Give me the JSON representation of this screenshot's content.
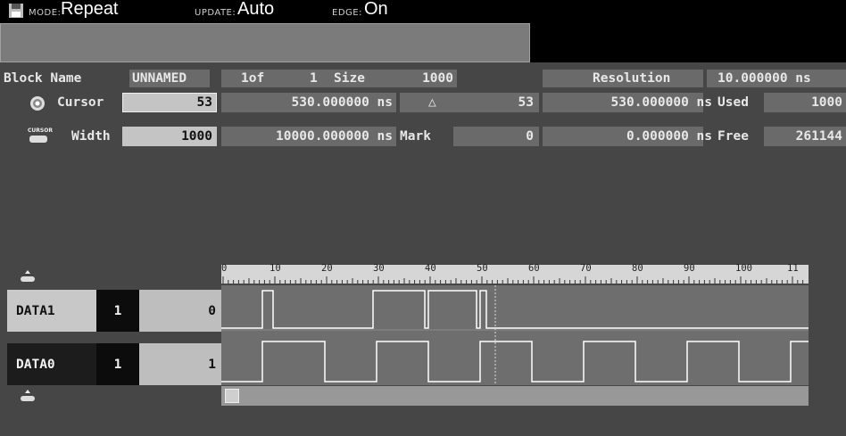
{
  "topbar": {
    "mode_label": "MODE:",
    "mode_value": "Repeat",
    "update_label": "UPDATE:",
    "update_value": "Auto",
    "edge_label": "EDGE:",
    "edge_value": "On"
  },
  "info": {
    "block_name_label": "Block Name",
    "block_name_value": "UNNAMED",
    "block_index": "1of",
    "block_count": "1",
    "size_label": "Size",
    "size_value": "1000",
    "resolution_label": "Resolution",
    "resolution_value": "10.000000 ns",
    "cursor_label": "Cursor",
    "cursor_value": "53",
    "cursor_time": "530.000000 ns",
    "delta_symbol": "△",
    "delta_value": "53",
    "delta_time": "530.000000 ns",
    "used_label": "Used",
    "used_value": "1000",
    "width_label": "Width",
    "width_value": "1000",
    "width_time": "10000.000000 ns",
    "mark_label": "Mark",
    "mark_value": "0",
    "mark_time": "0.000000 ns",
    "free_label": "Free",
    "free_value": "261144",
    "cursor_icon_text": "CURSOR"
  },
  "ruler": {
    "ticks": [
      "0",
      "10",
      "20",
      "30",
      "40",
      "50",
      "60",
      "70",
      "80",
      "90",
      "100",
      "11"
    ]
  },
  "channels": [
    {
      "name": "DATA1",
      "radix": "1",
      "value": "0"
    },
    {
      "name": "DATA0",
      "radix": "1",
      "value": "1"
    }
  ],
  "colors": {
    "background": "#464646",
    "topbar": "#000000",
    "waveform": "#ffffff",
    "cursor_line": "#e0e0e0"
  }
}
